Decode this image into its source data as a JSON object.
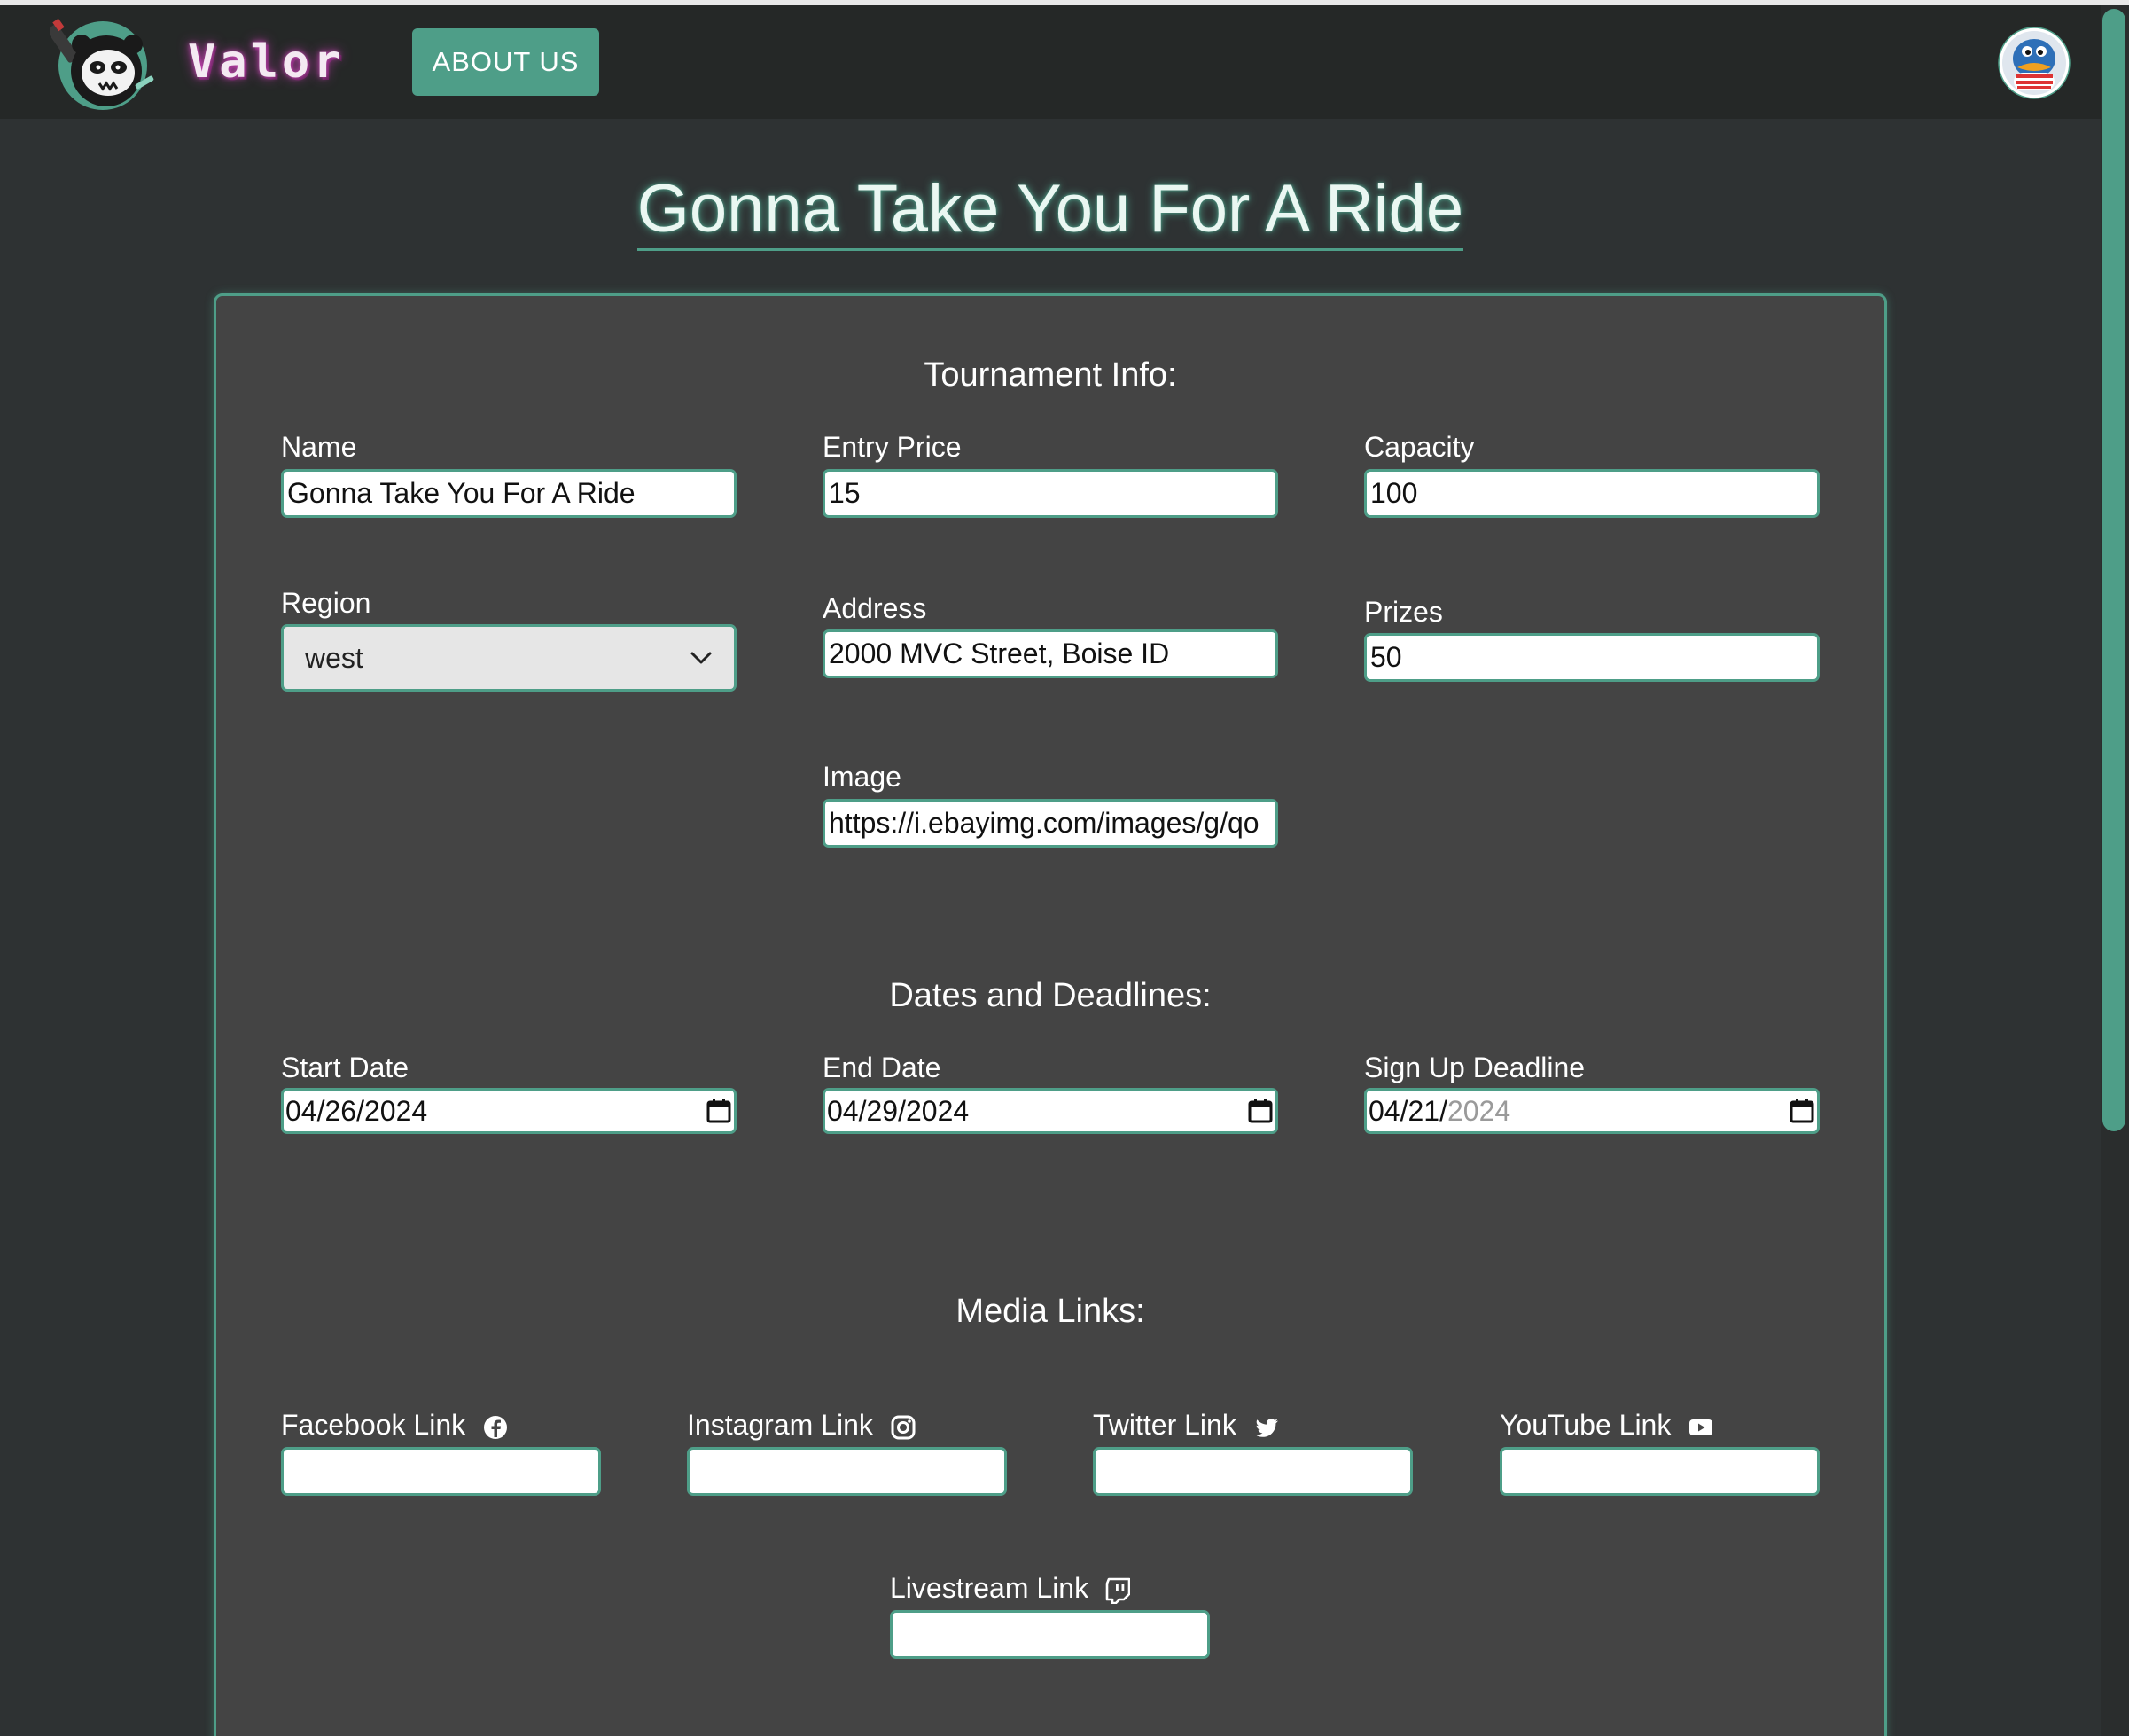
{
  "nav": {
    "brand": "Valor",
    "about_label": "ABOUT US"
  },
  "page": {
    "title": "Gonna Take You For A Ride"
  },
  "form": {
    "tournament_section": "Tournament Info:",
    "name": {
      "label": "Name",
      "value": "Gonna Take You For A Ride"
    },
    "entry_price": {
      "label": "Entry Price",
      "value": "15"
    },
    "capacity": {
      "label": "Capacity",
      "value": "100"
    },
    "region": {
      "label": "Region",
      "value": "west"
    },
    "address": {
      "label": "Address",
      "value": "2000 MVC Street, Boise ID"
    },
    "prizes": {
      "label": "Prizes",
      "value": "50"
    },
    "image": {
      "label": "Image",
      "value": "https://i.ebayimg.com/images/g/qo"
    },
    "dates_section": "Dates and Deadlines:",
    "start_date": {
      "label": "Start Date",
      "value": "04/26/2024"
    },
    "end_date": {
      "label": "End Date",
      "value": "04/29/2024"
    },
    "signup_deadline": {
      "label": "Sign Up Deadline",
      "value_entered": "04/21/",
      "value_placeholder": "2024"
    },
    "media_section": "Media Links:",
    "facebook": {
      "label": "Facebook Link",
      "icon": "facebook-icon"
    },
    "instagram": {
      "label": "Instagram Link",
      "icon": "instagram-icon"
    },
    "twitter": {
      "label": "Twitter Link",
      "icon": "twitter-icon"
    },
    "youtube": {
      "label": "YouTube Link",
      "icon": "youtube-icon"
    },
    "livestream": {
      "label": "Livestream Link",
      "icon": "twitch-icon"
    }
  },
  "colors": {
    "accent": "#4e9e88",
    "background": "#2e3233",
    "navbar": "#252827",
    "card": "#444444"
  }
}
